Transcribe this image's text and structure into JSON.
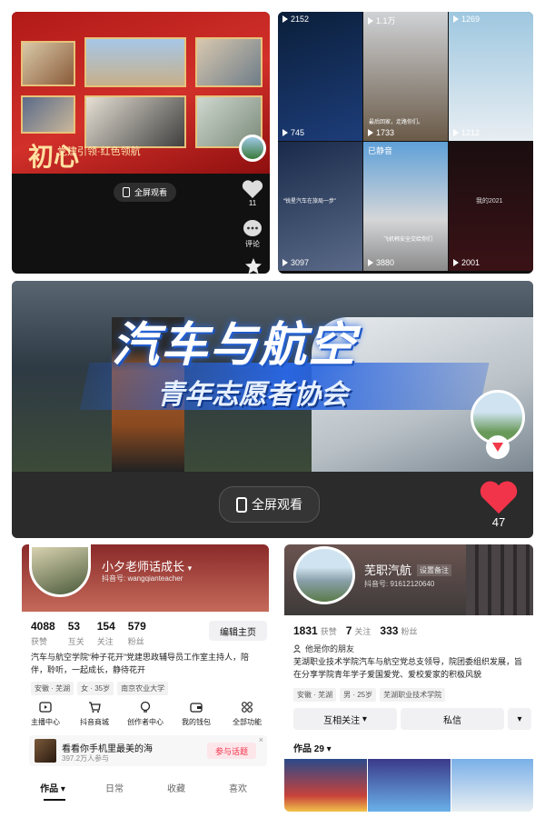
{
  "panel1": {
    "banner_big": "初心",
    "banner_text": "党建引领·红色领航",
    "fullscreen_label": "全屏观看",
    "like_count": "11",
    "comment_label": "评论"
  },
  "panel2": {
    "cells": [
      {
        "count": "2152",
        "caption": ""
      },
      {
        "count": "1.1万",
        "caption": ""
      },
      {
        "count": "1269",
        "caption": ""
      },
      {
        "count": "745",
        "caption": "最后回家，走路你们。"
      },
      {
        "count": "1733",
        "caption": ""
      },
      {
        "count": "1212",
        "caption": ""
      },
      {
        "count": "3097",
        "caption": "“锐星汽车在旅局一步”"
      },
      {
        "count": "3880",
        "caption": "飞机韩安全交给你们",
        "top": "已静音"
      },
      {
        "count": "2001",
        "caption": "我的2021"
      }
    ]
  },
  "panel3": {
    "title": "汽车与航空",
    "subtitle": "青年志愿者协会",
    "fullscreen_label": "全屏观看",
    "like_count": "47"
  },
  "profile1": {
    "name": "小夕老师话成长",
    "douyin_id": "抖音号: wangqianteacher",
    "stats": [
      {
        "num": "4088",
        "label": "获赞"
      },
      {
        "num": "53",
        "label": "互关"
      },
      {
        "num": "154",
        "label": "关注"
      },
      {
        "num": "579",
        "label": "粉丝"
      }
    ],
    "edit_label": "编辑主页",
    "bio": "汽车与航空学院“种子花开”党建思政辅导员工作室主持人，陪伴，聆听，一起成长，静待花开",
    "tags": [
      "安徽 · 芜湖",
      "女 · 35岁",
      "南京农业大学"
    ],
    "functions": [
      {
        "icon": "broadcast-icon",
        "label": "主播中心"
      },
      {
        "icon": "cart-icon",
        "label": "抖音商城"
      },
      {
        "icon": "lightbulb-icon",
        "label": "创作者中心"
      },
      {
        "icon": "wallet-icon",
        "label": "我的钱包"
      },
      {
        "icon": "grid-icon",
        "label": "全部功能"
      }
    ],
    "promo_title": "看看你手机里最美的海",
    "promo_sub": "397.2万人参与",
    "promo_button": "参与话题",
    "tabs": [
      "作品",
      "日常",
      "收藏",
      "喜欢"
    ]
  },
  "profile2": {
    "name": "芜职汽航",
    "remark": "设置备注",
    "douyin_id": "抖音号: 91612120640",
    "stats": [
      {
        "num": "1831",
        "label": "获赞"
      },
      {
        "num": "7",
        "label": "关注"
      },
      {
        "num": "333",
        "label": "粉丝"
      }
    ],
    "friend_note": "他是你的朋友",
    "bio": "芜湖职业技术学院汽车与航空党总支领导，院团委组织发展，旨在分享学院青年学子爱国爱党、爱校爱家的积极风貌",
    "tags": [
      "安徽 · 芜湖",
      "男 · 25岁",
      "芜湖职业技术学院"
    ],
    "mutual_label": "互相关注",
    "message_label": "私信",
    "works_label": "作品 29"
  }
}
